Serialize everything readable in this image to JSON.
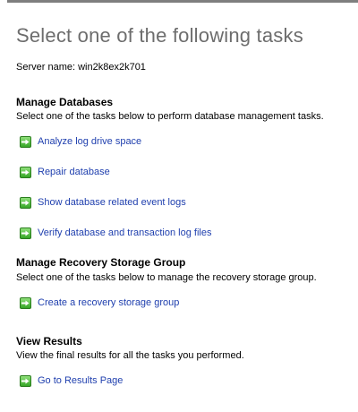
{
  "page": {
    "title": "Select one of the following tasks",
    "server_name_label": "Server name:",
    "server_name_value": "win2k8ex2k701"
  },
  "sections": [
    {
      "heading": "Manage Databases",
      "description": "Select one of the tasks below to perform database management tasks.",
      "tasks": [
        {
          "label": "Analyze log drive space",
          "icon": "green-arrow-icon"
        },
        {
          "label": "Repair database",
          "icon": "green-arrow-icon"
        },
        {
          "label": "Show database related event logs",
          "icon": "green-arrow-icon"
        },
        {
          "label": "Verify database and transaction log files",
          "icon": "green-arrow-icon"
        }
      ]
    },
    {
      "heading": "Manage Recovery Storage Group",
      "description": "Select one of the tasks below to manage the recovery storage group.",
      "tasks": [
        {
          "label": "Create a recovery storage group",
          "icon": "green-arrow-icon"
        }
      ]
    },
    {
      "heading": "View Results",
      "description": "View the final results for all the tasks you performed.",
      "tasks": [
        {
          "label": "Go to Results Page",
          "icon": "green-arrow-icon"
        }
      ]
    }
  ],
  "colors": {
    "title": "#6d6d6d",
    "link": "#1f3fae",
    "icon_green": "#36a626"
  }
}
